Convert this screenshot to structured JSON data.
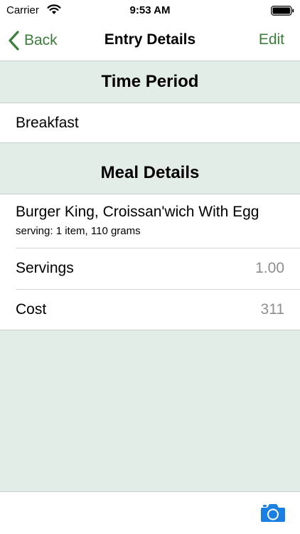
{
  "status_bar": {
    "carrier": "Carrier",
    "time": "9:53 AM"
  },
  "nav": {
    "back_label": "Back",
    "title": "Entry Details",
    "edit_label": "Edit"
  },
  "sections": {
    "time_period": {
      "header": "Time Period",
      "value": "Breakfast"
    },
    "meal_details": {
      "header": "Meal Details",
      "food_name": "Burger King, Croissan'wich With Egg",
      "serving": "serving: 1 item, 110 grams",
      "servings_label": "Servings",
      "servings_value": "1.00",
      "cost_label": "Cost",
      "cost_value": "311"
    }
  },
  "colors": {
    "accent": "#3b7d3a",
    "background": "#e3ede8",
    "camera": "#1a7fe0"
  },
  "icons": {
    "back": "chevron-left-icon",
    "wifi": "wifi-icon",
    "battery": "battery-icon",
    "camera": "camera-icon"
  }
}
